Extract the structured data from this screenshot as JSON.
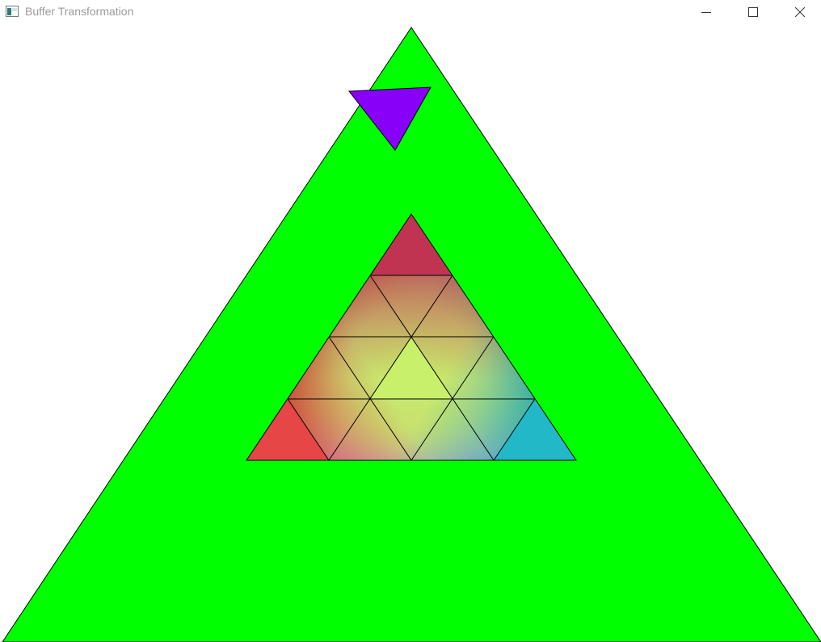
{
  "window": {
    "title": "Buffer Transformation",
    "app_icon": "window-app-icon",
    "controls": {
      "minimize_icon": "minimize-icon",
      "maximize_icon": "maximize-icon",
      "close_icon": "close-icon"
    }
  },
  "scene": {
    "background_color": "#ffffff",
    "outer_triangle_color": "#00ff00",
    "small_triangle_color": "#8800f8",
    "inner_corner_colors": {
      "top": "#c03452",
      "bottom_left": "#e64646",
      "bottom_right": "#22b8c8",
      "center": "#c8f06a"
    },
    "outline_color": "#000000"
  }
}
